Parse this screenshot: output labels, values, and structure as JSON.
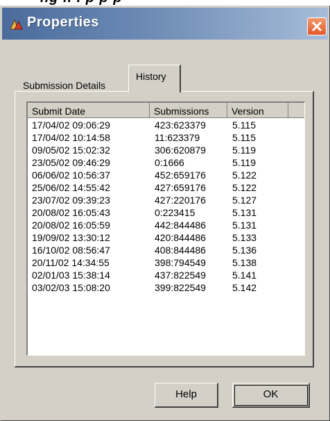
{
  "window": {
    "title": "Properties",
    "top_strip_text": "ng .. . p p p"
  },
  "tabs": [
    {
      "label": "Submission Details",
      "active": false
    },
    {
      "label": "History",
      "active": true
    }
  ],
  "history": {
    "columns": [
      "Submit Date",
      "Submissions",
      "Version"
    ],
    "rows": [
      {
        "date": "17/04/02 09:06:29",
        "submissions": "423:623379",
        "version": "5.115"
      },
      {
        "date": "17/04/02 10:14:58",
        "submissions": "11:623379",
        "version": "5.115"
      },
      {
        "date": "09/05/02 15:02:32",
        "submissions": "306:620879",
        "version": "5.119"
      },
      {
        "date": "23/05/02 09:46:29",
        "submissions": "0:1666",
        "version": "5.119"
      },
      {
        "date": "06/06/02 10:56:37",
        "submissions": "452:659176",
        "version": "5.122"
      },
      {
        "date": "25/06/02 14:55:42",
        "submissions": "427:659176",
        "version": "5.122"
      },
      {
        "date": "23/07/02 09:39:23",
        "submissions": "427:220176",
        "version": "5.127"
      },
      {
        "date": "20/08/02 16:05:43",
        "submissions": "0:223415",
        "version": "5.131"
      },
      {
        "date": "20/08/02 16:05:59",
        "submissions": "442:844486",
        "version": "5.131"
      },
      {
        "date": "19/09/02 13:30:12",
        "submissions": "420:844486",
        "version": "5.133"
      },
      {
        "date": "16/10/02 08:56:47",
        "submissions": "408:844486",
        "version": "5.136"
      },
      {
        "date": "20/11/02 14:34:55",
        "submissions": "398:794549",
        "version": "5.138"
      },
      {
        "date": "02/01/03 15:38:14",
        "submissions": "437:822549",
        "version": "5.141"
      },
      {
        "date": "03/02/03 15:08:20",
        "submissions": "399:822549",
        "version": "5.142"
      }
    ]
  },
  "buttons": {
    "help": "Help",
    "ok": "OK"
  },
  "icons": {
    "title_icon": "app-icon",
    "close": "close-icon"
  },
  "colors": {
    "titlebar_start": "#4a6b9c",
    "titlebar_end": "#a6bcd8",
    "dialog_face": "#d4d0c8",
    "close_button": "#e2572a"
  }
}
